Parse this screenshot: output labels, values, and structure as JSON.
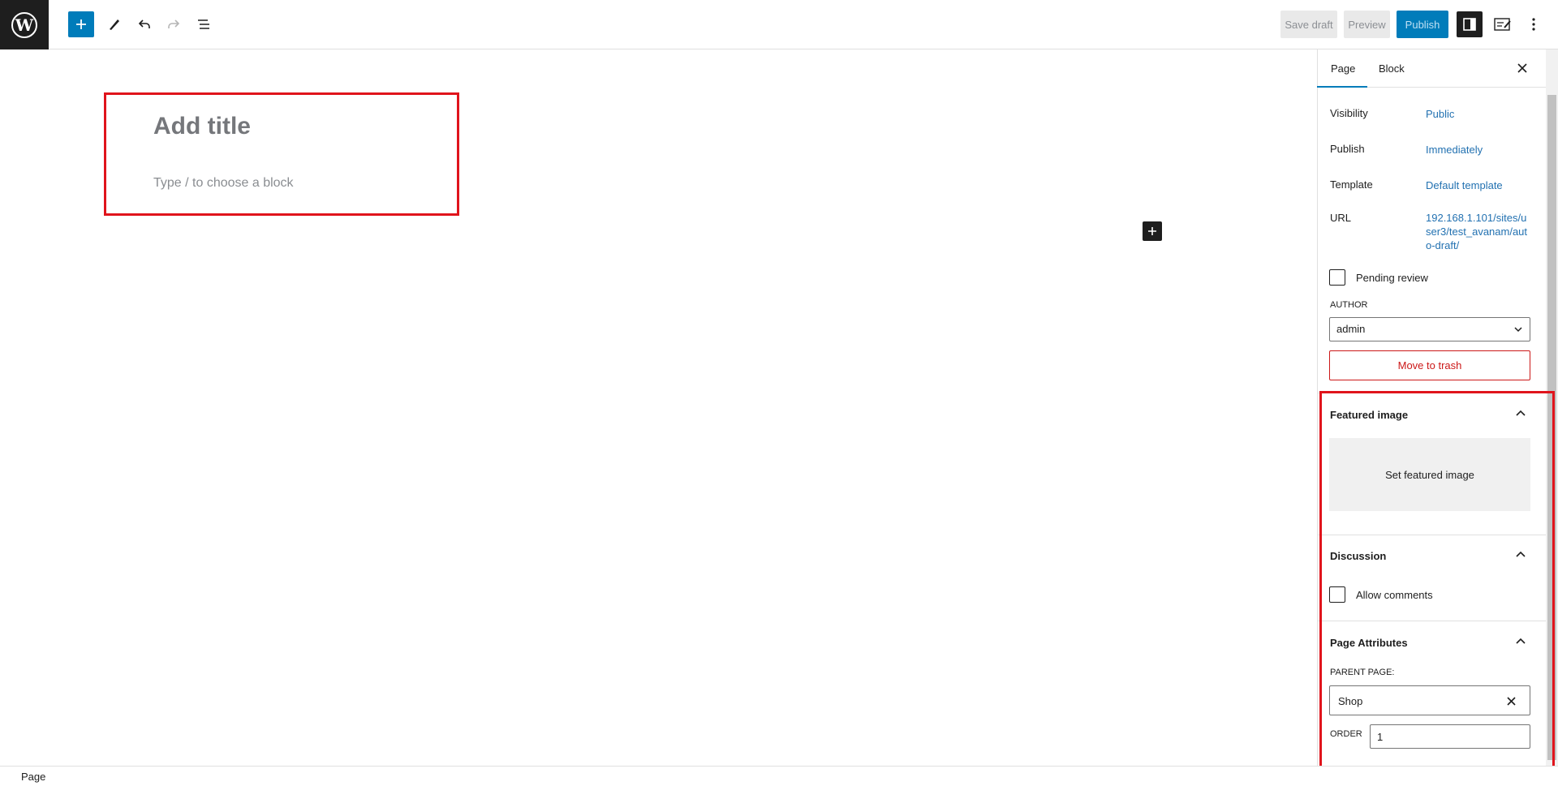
{
  "toolbar": {
    "logo_icon": "wordpress-logo-icon",
    "add_block_icon": "plus-icon",
    "tools_icon": "pencil-icon",
    "undo_icon": "undo-icon",
    "redo_icon": "redo-icon",
    "list_view_icon": "list-view-icon",
    "save_draft_label": "Save draft",
    "preview_label": "Preview",
    "publish_label": "Publish",
    "settings_icon": "sidebar-toggle-icon",
    "plugin_icon": "edit-note-icon",
    "options_icon": "more-vertical-icon",
    "accent": "#007cba"
  },
  "editor": {
    "title_placeholder": "Add title",
    "block_placeholder": "Type / to choose a block",
    "inline_add_icon": "plus-icon"
  },
  "sidebar": {
    "tabs": [
      {
        "label": "Page",
        "active": true
      },
      {
        "label": "Block",
        "active": false
      }
    ],
    "close_icon": "close-icon",
    "summary": {
      "visibility_label": "Visibility",
      "visibility_value": "Public",
      "publish_label": "Publish",
      "publish_value": "Immediately",
      "template_label": "Template",
      "template_value": "Default template",
      "url_label": "URL",
      "url_value": "192.168.1.101/sites/user3/test_avanam/auto-draft/",
      "pending_review_label": "Pending review",
      "pending_review_checked": false,
      "author_label": "AUTHOR",
      "author_value": "admin",
      "trash_label": "Move to trash"
    },
    "featured_image": {
      "title": "Featured image",
      "set_label": "Set featured image",
      "expanded": true
    },
    "discussion": {
      "title": "Discussion",
      "allow_comments_label": "Allow comments",
      "allow_comments_checked": false,
      "expanded": true
    },
    "page_attributes": {
      "title": "Page Attributes",
      "parent_label": "PARENT PAGE:",
      "parent_value": "Shop",
      "order_label": "ORDER",
      "order_value": "1",
      "expanded": true
    }
  },
  "footer": {
    "breadcrumb": "Page"
  }
}
